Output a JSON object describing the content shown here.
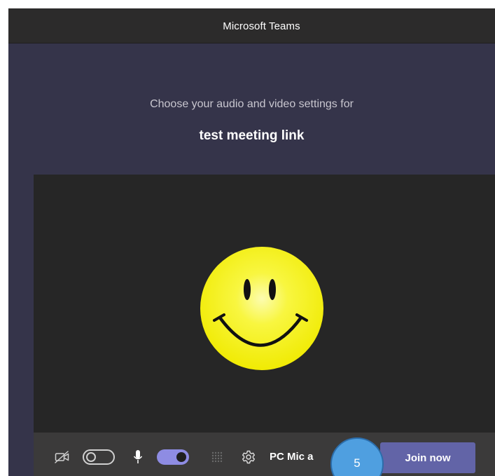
{
  "window": {
    "title": "Microsoft Teams"
  },
  "prejoin": {
    "subtitle": "Choose your audio and video settings for",
    "meeting_name": "test meeting link"
  },
  "toolbar": {
    "camera_icon": "camera-off-icon",
    "camera_toggle_on": false,
    "mic_icon": "microphone-icon",
    "mic_toggle_on": true,
    "blur_icon": "background-blur-icon",
    "settings_icon": "gear-icon",
    "device_label": "PC Mic a",
    "join_label": "Join now"
  },
  "annotation": {
    "step_number": "5"
  },
  "colors": {
    "window_bg": "#35344a",
    "titlebar_bg": "#2c2b2b",
    "preview_bg": "#262626",
    "toolbar_bg": "#3b3a3a",
    "accent": "#6264a7",
    "toggle_on": "#8e8ce3",
    "badge": "#4f9fe0",
    "smiley_yellow": "#f4f000"
  }
}
